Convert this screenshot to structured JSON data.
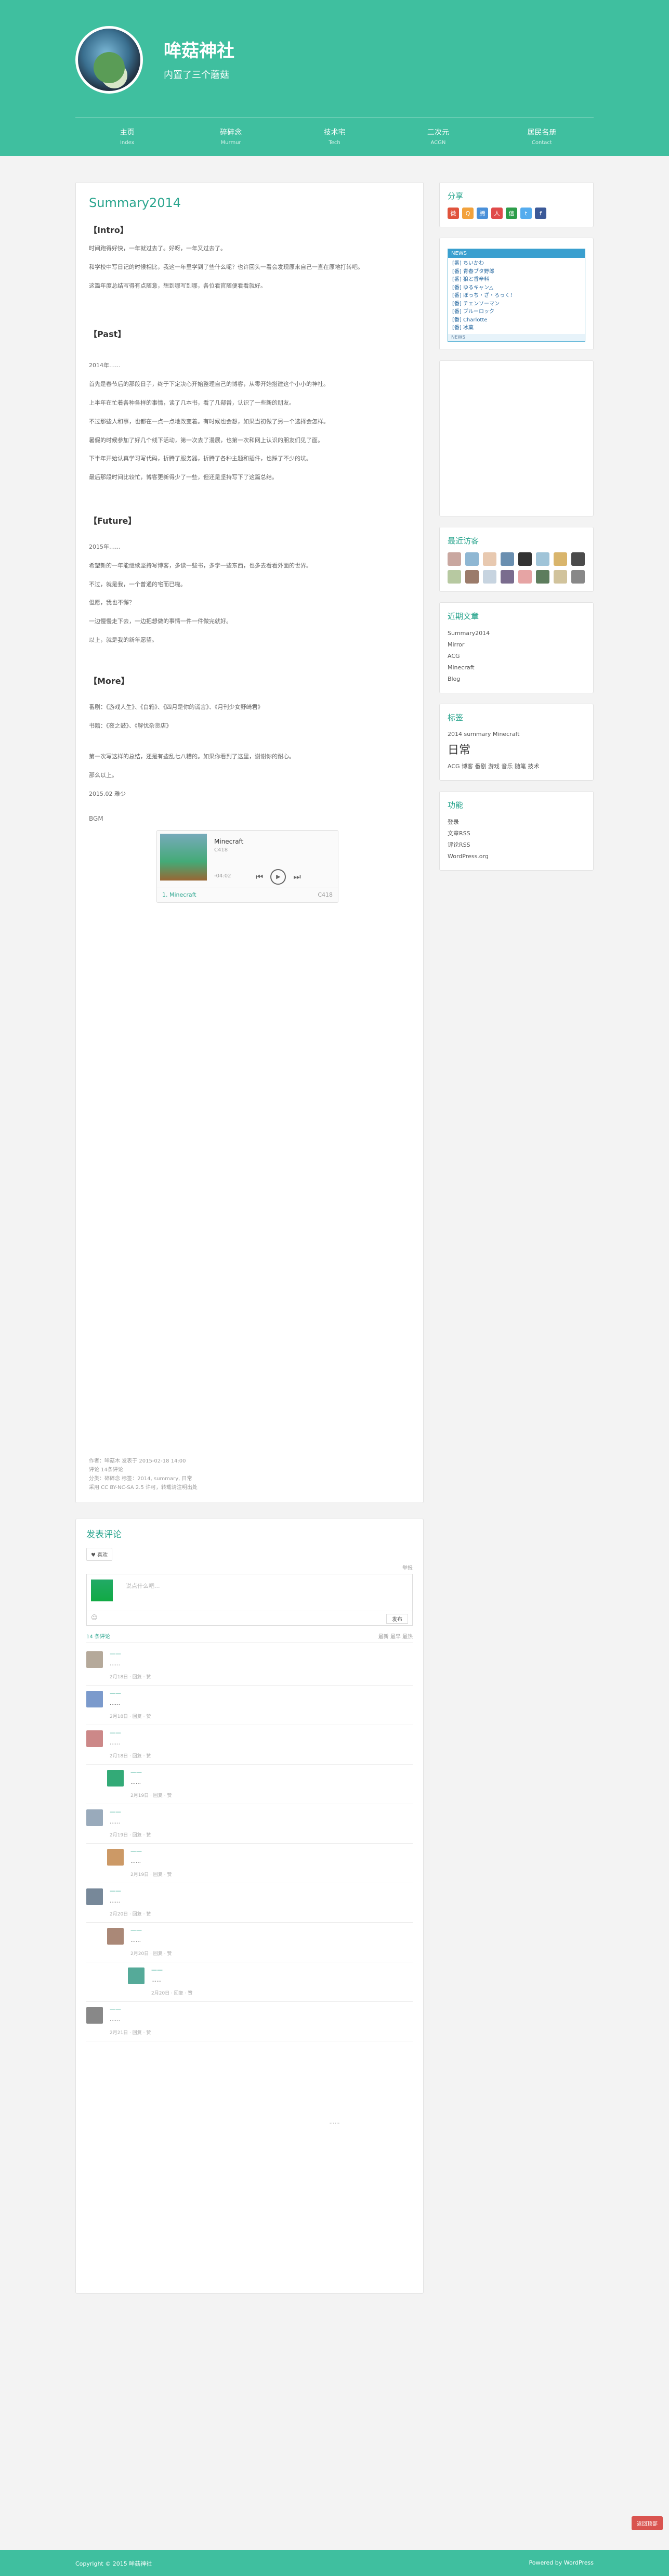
{
  "site": {
    "title": "哞菇神社",
    "subtitle": "内置了三个蘑菇"
  },
  "nav": [
    {
      "label": "主页",
      "sub": "Index"
    },
    {
      "label": "碎碎念",
      "sub": "Murmur"
    },
    {
      "label": "技术宅",
      "sub": "Tech"
    },
    {
      "label": "二次元",
      "sub": "ACGN"
    },
    {
      "label": "居民名册",
      "sub": "Contact"
    }
  ],
  "post": {
    "title": "Summary2014",
    "s1": "【Intro】",
    "p1": "时间跑得好快，一年就过去了。好呀，一年又过去了。",
    "p2": "和学校中写日记的时候相比，我这一年里学到了些什么呢？也许回头一看会发现原来自己一直在原地打转吧。",
    "p3": "这篇年度总结写得有点随意，想到哪写到哪，各位看官随便看看就好。",
    "s2": "【Past】",
    "p4": "2014年……",
    "p5": "首先是春节后的那段日子，终于下定决心开始整理自己的博客，从零开始搭建这个小小的神社。",
    "p6": "上半年在忙着各种各样的事情，读了几本书，看了几部番，认识了一些新的朋友。",
    "p7": "不过那些人和事，也都在一点一点地改变着。有时候也会想，如果当初做了另一个选择会怎样。",
    "p8": "暑假的时候参加了好几个线下活动，第一次去了漫展，也第一次和网上认识的朋友们见了面。",
    "p9": "下半年开始认真学习写代码，折腾了服务器，折腾了各种主题和插件，也踩了不少的坑。",
    "p10": "最后那段时间比较忙，博客更新得少了一些，但还是坚持写下了这篇总结。",
    "s3": "【Future】",
    "p11": "2015年……",
    "p12": "希望新的一年能继续坚持写博客，多读一些书，多学一些东西，也多去看看外面的世界。",
    "p13": "不过，就是我，一个普通的宅而已啦。",
    "p14": "但愿，我也不懈？",
    "p15": "一边慢慢走下去，一边把想做的事情一件一件做完就好。",
    "p16": "以上，就是我的新年愿望。",
    "s4": "【More】",
    "p17": "番剧：《游戏人生》、《白箱》、《四月是你的谎言》、《月刊少女野崎君》",
    "p18": "书籍：《夜之鼓》、《解忧杂货店》",
    "p19": "第一次写这样的总结，还是有些乱七八糟的。如果你看到了这里，谢谢你的耐心。",
    "p20": "那么以上。",
    "p21": "2015.02 雅少",
    "bgm": "BGM",
    "player": {
      "title": "Minecraft",
      "artist": "C418",
      "time": "-04:02",
      "track": "1. Minecraft",
      "dur": "C418"
    },
    "meta1": "作者：哞菇木 发表于 2015-02-18 14:00",
    "meta2": "评论 14条评论",
    "meta3": "分类：碎碎念  标签：2014, summary, 日常",
    "meta4": "采用 CC BY-NC-SA 2.5 许可，转载请注明出处"
  },
  "side": {
    "share_title": "分享",
    "widget_bar": "NEWS",
    "widget_items": [
      "[番] ちいかわ",
      "[番] 青春ブタ野郎",
      "[番] 狼と香辛料",
      "[番] ゆるキャン△",
      "[番] ぼっち・ざ・ろっく！",
      "[番] チェンソーマン",
      "[番] ブルーロック",
      "[番] Charlotte",
      "[番] 冰菓"
    ],
    "widget_foot": "NEWS",
    "recent_title": "最近访客",
    "posts_title": "近期文章",
    "posts": [
      "Summary2014",
      "Mirror",
      "ACG",
      "Minecraft",
      "Blog"
    ],
    "tags_title": "标签",
    "tag_line1": "2014 summary Minecraft",
    "tag_big": "日常",
    "tag_line2": "ACG 博客 番剧 游戏 音乐 随笔 技术",
    "func_title": "功能",
    "funcs": [
      "登录",
      "文章RSS",
      "评论RSS",
      "WordPress.org"
    ]
  },
  "comments": {
    "title": "发表评论",
    "like": "♥ 喜欢",
    "tools": "举报",
    "placeholder": "说点什么吧...",
    "submit": "发布",
    "count": "14 条评论",
    "sort": "最新 最早 最热",
    "list": [
      {
        "author": "——",
        "text": "……",
        "meta": "2月18日 · 回复 · 赞"
      },
      {
        "author": "——",
        "text": "……",
        "meta": "2月18日 · 回复 · 赞"
      },
      {
        "author": "——",
        "text": "……",
        "meta": "2月18日 · 回复 · 赞"
      },
      {
        "author": "——",
        "text": "……",
        "meta": "2月19日 · 回复 · 赞"
      },
      {
        "author": "——",
        "text": "……",
        "meta": "2月19日 · 回复 · 赞"
      },
      {
        "author": "——",
        "text": "……",
        "meta": "2月19日 · 回复 · 赞"
      },
      {
        "author": "——",
        "text": "……",
        "meta": "2月20日 · 回复 · 赞"
      },
      {
        "author": "——",
        "text": "……",
        "meta": "2月20日 · 回复 · 赞"
      },
      {
        "author": "——",
        "text": "……",
        "meta": "2月20日 · 回复 · 赞"
      },
      {
        "author": "——",
        "text": "……",
        "meta": "2月21日 · 回复 · 赞"
      }
    ]
  },
  "footer_note": "……",
  "footer_left": "Copyright © 2015 哞菇神社",
  "footer_right": "Powered by WordPress",
  "fab": "返回顶部"
}
